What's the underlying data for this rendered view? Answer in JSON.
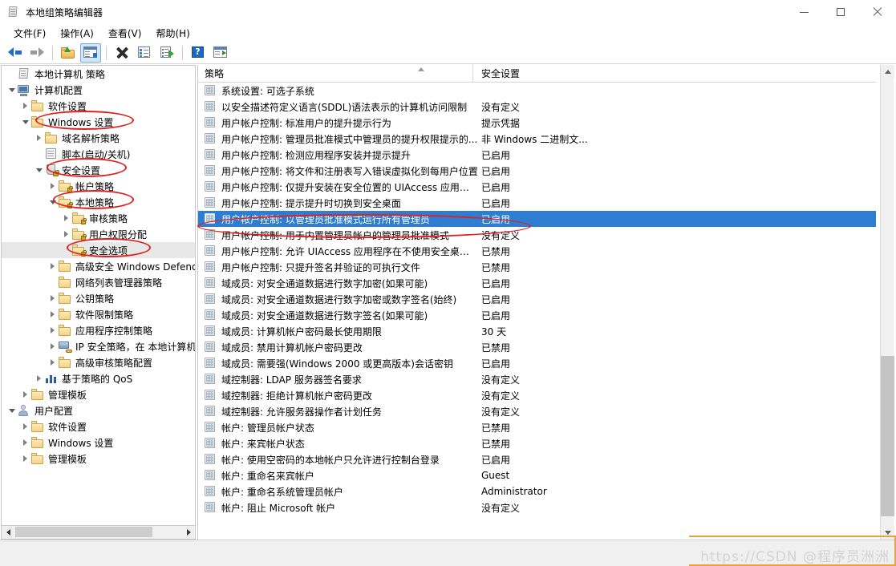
{
  "window": {
    "title": "本地组策略编辑器",
    "icon": "policy-document-icon",
    "minimize_label": "–",
    "maximize_label": "□",
    "close_label": "×"
  },
  "menubar": {
    "items": [
      {
        "label": "文件(F)",
        "name": "menu-file"
      },
      {
        "label": "操作(A)",
        "name": "menu-action"
      },
      {
        "label": "查看(V)",
        "name": "menu-view"
      },
      {
        "label": "帮助(H)",
        "name": "menu-help"
      }
    ]
  },
  "toolbar": {
    "buttons": [
      {
        "icon": "back-arrow-icon",
        "tooltip": "后退"
      },
      {
        "icon": "forward-arrow-icon",
        "tooltip": "前进"
      },
      {
        "icon": "up-folder-icon",
        "tooltip": "上移一级"
      },
      {
        "icon": "show-hide-tree-icon",
        "tooltip": "显示/隐藏控制台树",
        "active": true
      },
      {
        "icon": "delete-x-icon",
        "tooltip": "删除"
      },
      {
        "icon": "properties-icon",
        "tooltip": "属性"
      },
      {
        "icon": "export-list-icon",
        "tooltip": "导出列表"
      },
      {
        "icon": "help-question-icon",
        "tooltip": "帮助"
      },
      {
        "icon": "show-action-pane-icon",
        "tooltip": "显示/隐藏操作窗格"
      }
    ]
  },
  "tree": {
    "items": [
      {
        "label": "本地计算机 策略",
        "indent": 0,
        "chevron": "none",
        "icon": "policy-document-icon"
      },
      {
        "label": "计算机配置",
        "indent": 0,
        "chevron": "open",
        "icon": "computer-icon"
      },
      {
        "label": "软件设置",
        "indent": 1,
        "chevron": "closed",
        "icon": "folder-icon"
      },
      {
        "label": "Windows 设置",
        "indent": 1,
        "chevron": "open",
        "icon": "folder-icon",
        "circled": true
      },
      {
        "label": "域名解析策略",
        "indent": 2,
        "chevron": "closed",
        "icon": "folder-icon"
      },
      {
        "label": "脚本(启动/关机)",
        "indent": 2,
        "chevron": "none",
        "icon": "script-icon"
      },
      {
        "label": "安全设置",
        "indent": 2,
        "chevron": "open",
        "icon": "shield-lock-icon",
        "circled": true
      },
      {
        "label": "帐户策略",
        "indent": 3,
        "chevron": "closed",
        "icon": "folder-lock-icon"
      },
      {
        "label": "本地策略",
        "indent": 3,
        "chevron": "open",
        "icon": "folder-lock-icon",
        "circled": true
      },
      {
        "label": "审核策略",
        "indent": 4,
        "chevron": "closed",
        "icon": "folder-lock-icon"
      },
      {
        "label": "用户权限分配",
        "indent": 4,
        "chevron": "closed",
        "icon": "folder-lock-icon"
      },
      {
        "label": "安全选项",
        "indent": 4,
        "chevron": "none",
        "icon": "folder-lock-icon",
        "circled": true,
        "current": true
      },
      {
        "label": "高级安全 Windows Defend",
        "indent": 3,
        "chevron": "closed",
        "icon": "folder-icon"
      },
      {
        "label": "网络列表管理器策略",
        "indent": 3,
        "chevron": "none",
        "icon": "folder-icon"
      },
      {
        "label": "公钥策略",
        "indent": 3,
        "chevron": "closed",
        "icon": "folder-icon"
      },
      {
        "label": "软件限制策略",
        "indent": 3,
        "chevron": "closed",
        "icon": "folder-icon"
      },
      {
        "label": "应用程序控制策略",
        "indent": 3,
        "chevron": "closed",
        "icon": "folder-icon"
      },
      {
        "label": "IP 安全策略，在 本地计算机",
        "indent": 3,
        "chevron": "closed",
        "icon": "ipsec-icon"
      },
      {
        "label": "高级审核策略配置",
        "indent": 3,
        "chevron": "closed",
        "icon": "folder-icon"
      },
      {
        "label": "基于策略的 QoS",
        "indent": 2,
        "chevron": "closed",
        "icon": "qos-chart-icon"
      },
      {
        "label": "管理模板",
        "indent": 1,
        "chevron": "closed",
        "icon": "folder-icon"
      },
      {
        "label": "用户配置",
        "indent": 0,
        "chevron": "open",
        "icon": "user-icon"
      },
      {
        "label": "软件设置",
        "indent": 1,
        "chevron": "closed",
        "icon": "folder-icon"
      },
      {
        "label": "Windows 设置",
        "indent": 1,
        "chevron": "closed",
        "icon": "folder-icon"
      },
      {
        "label": "管理模板",
        "indent": 1,
        "chevron": "closed",
        "icon": "folder-icon"
      }
    ]
  },
  "list": {
    "columns": [
      {
        "label": "策略",
        "name": "column-policy",
        "sorted": "asc"
      },
      {
        "label": "安全设置",
        "name": "column-security-setting"
      }
    ],
    "rows": [
      {
        "policy": "系统设置: 可选子系统",
        "setting": ""
      },
      {
        "policy": "以安全描述符定义语言(SDDL)语法表示的计算机访问限制",
        "setting": "没有定义"
      },
      {
        "policy": "用户帐户控制: 标准用户的提升提示行为",
        "setting": "提示凭据"
      },
      {
        "policy": "用户帐户控制: 管理员批准模式中管理员的提升权限提示的...",
        "setting": "非 Windows 二进制文..."
      },
      {
        "policy": "用户帐户控制: 检测应用程序安装并提示提升",
        "setting": "已启用"
      },
      {
        "policy": "用户帐户控制: 将文件和注册表写入错误虚拟化到每用户位置",
        "setting": "已启用"
      },
      {
        "policy": "用户帐户控制: 仅提升安装在安全位置的 UIAccess 应用程序",
        "setting": "已启用"
      },
      {
        "policy": "用户帐户控制: 提示提升时切换到安全桌面",
        "setting": "已启用"
      },
      {
        "policy": "用户帐户控制: 以管理员批准模式运行所有管理员",
        "setting": "已启用",
        "selected": true
      },
      {
        "policy": "用户帐户控制: 用于内置管理员帐户的管理员批准模式",
        "setting": "没有定义"
      },
      {
        "policy": "用户帐户控制: 允许 UIAccess 应用程序在不使用安全桌面...",
        "setting": "已禁用"
      },
      {
        "policy": "用户帐户控制: 只提升签名并验证的可执行文件",
        "setting": "已禁用"
      },
      {
        "policy": "域成员: 对安全通道数据进行数字加密(如果可能)",
        "setting": "已启用"
      },
      {
        "policy": "域成员: 对安全通道数据进行数字加密或数字签名(始终)",
        "setting": "已启用"
      },
      {
        "policy": "域成员: 对安全通道数据进行数字签名(如果可能)",
        "setting": "已启用"
      },
      {
        "policy": "域成员: 计算机帐户密码最长使用期限",
        "setting": "30 天"
      },
      {
        "policy": "域成员: 禁用计算机帐户密码更改",
        "setting": "已禁用"
      },
      {
        "policy": "域成员: 需要强(Windows 2000 或更高版本)会话密钥",
        "setting": "已启用"
      },
      {
        "policy": "域控制器: LDAP 服务器签名要求",
        "setting": "没有定义"
      },
      {
        "policy": "域控制器: 拒绝计算机帐户密码更改",
        "setting": "没有定义"
      },
      {
        "policy": "域控制器: 允许服务器操作者计划任务",
        "setting": "没有定义"
      },
      {
        "policy": "帐户: 管理员帐户状态",
        "setting": "已禁用"
      },
      {
        "policy": "帐户: 来宾帐户状态",
        "setting": "已禁用"
      },
      {
        "policy": "帐户: 使用空密码的本地帐户只允许进行控制台登录",
        "setting": "已启用"
      },
      {
        "policy": "帐户: 重命名来宾帐户",
        "setting": "Guest"
      },
      {
        "policy": "帐户: 重命名系统管理员帐户",
        "setting": "Administrator"
      },
      {
        "policy": "帐户: 阻止 Microsoft 帐户",
        "setting": "没有定义"
      }
    ]
  },
  "annotations": {
    "highlight_color": "#e02020",
    "selection_color": "#2d7dd2",
    "accent_color": "#e8a33d"
  },
  "watermark": {
    "text": "https://CSDN @程序员洲洲"
  },
  "scrollbars": {
    "vertical_up": "▲",
    "vertical_down": "▼",
    "horizontal_left": "◀",
    "horizontal_right": "▶"
  }
}
